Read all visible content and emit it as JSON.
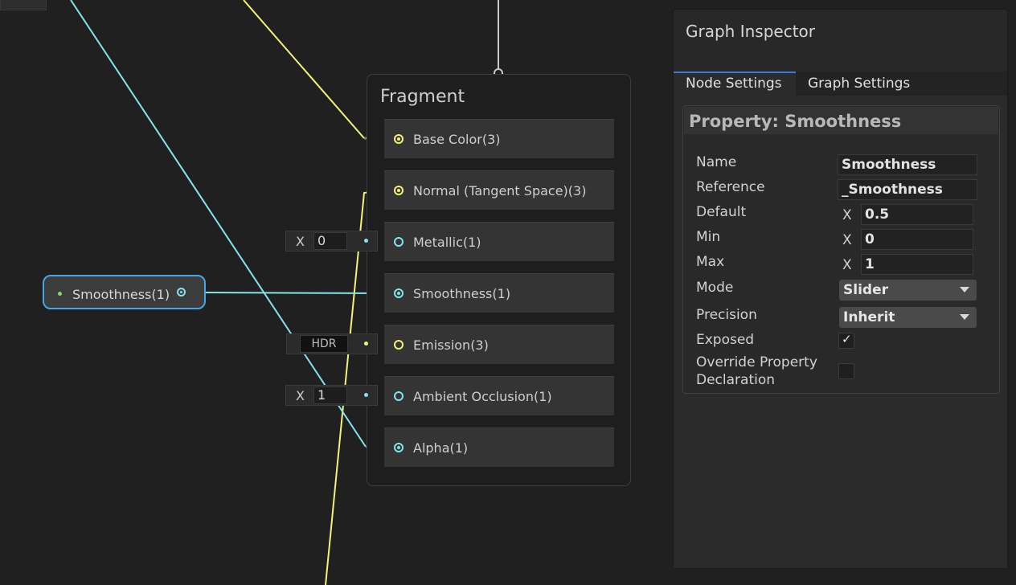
{
  "graph": {
    "fragment_title": "Fragment",
    "ports": [
      {
        "label": "Base Color(3)",
        "color": "yellow"
      },
      {
        "label": "Normal (Tangent Space)(3)",
        "color": "yellow"
      },
      {
        "label": "Metallic(1)",
        "color": "cyan"
      },
      {
        "label": "Smoothness(1)",
        "color": "cyan"
      },
      {
        "label": "Emission(3)",
        "color": "yellow"
      },
      {
        "label": "Ambient Occlusion(1)",
        "color": "cyan"
      },
      {
        "label": "Alpha(1)",
        "color": "cyan"
      }
    ],
    "metallic_input": {
      "axis": "X",
      "value": "0"
    },
    "emission_input": {
      "label": "HDR"
    },
    "ao_input": {
      "axis": "X",
      "value": "1"
    },
    "property_node": {
      "label": "Smoothness(1)"
    }
  },
  "inspector": {
    "title": "Graph Inspector",
    "tabs": [
      "Node Settings",
      "Graph Settings"
    ],
    "property_header": "Property: Smoothness",
    "name_label": "Name",
    "name_value": "Smoothness",
    "reference_label": "Reference",
    "reference_value": "_Smoothness",
    "default_label": "Default",
    "default_value": "0.5",
    "min_label": "Min",
    "min_value": "0",
    "max_label": "Max",
    "max_value": "1",
    "axis_label": "X",
    "mode_label": "Mode",
    "mode_value": "Slider",
    "precision_label": "Precision",
    "precision_value": "Inherit",
    "exposed_label": "Exposed",
    "exposed_checked": true,
    "override_label_line1": "Override Property",
    "override_label_line2": "Declaration",
    "override_checked": false
  },
  "colors": {
    "cyan_wire": "#84e4e7",
    "yellow_wire": "#f3f37a",
    "selection": "#45a6e6",
    "tab_accent": "#3a7bd5"
  }
}
